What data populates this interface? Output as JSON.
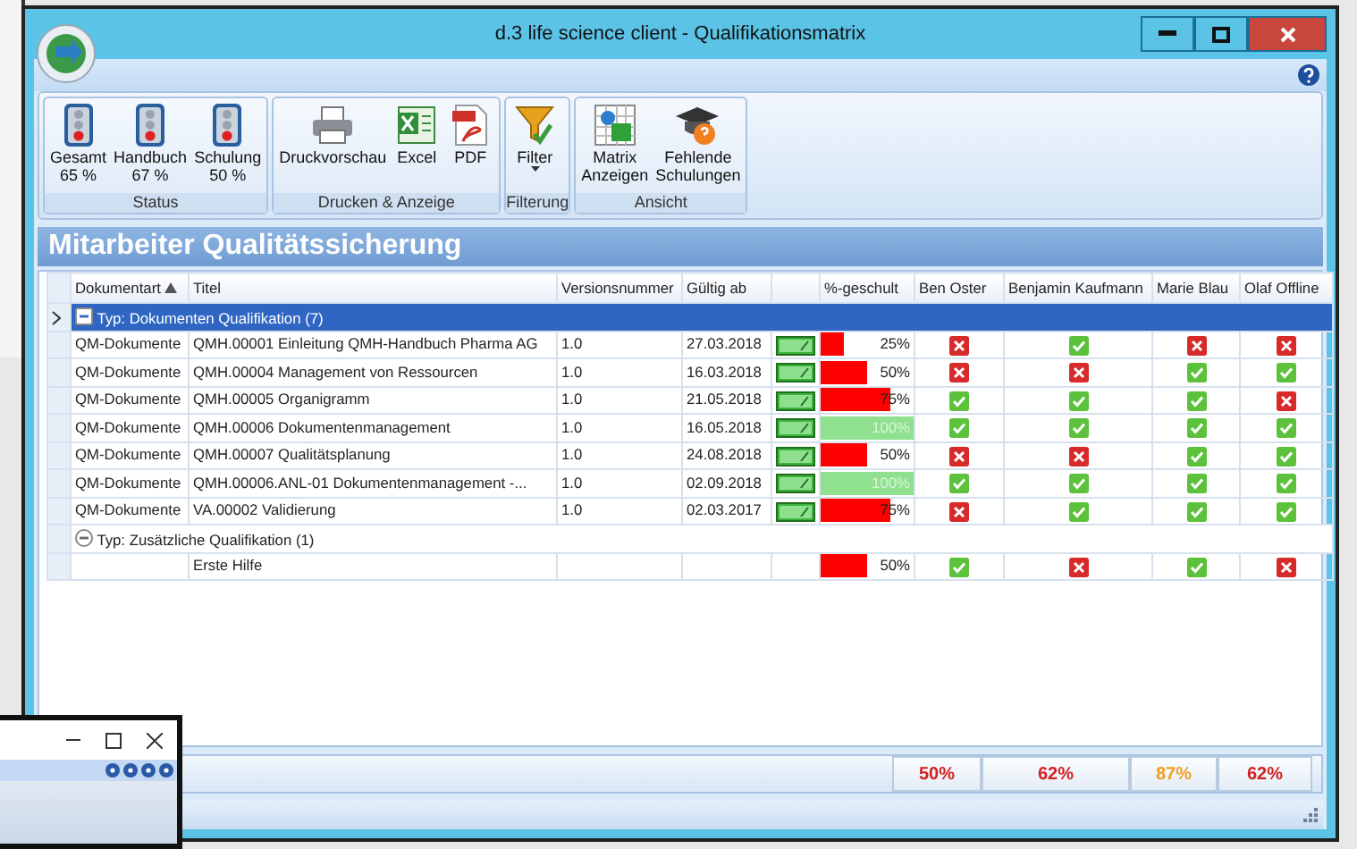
{
  "window": {
    "title": "d.3 life science client - Qualifikationsmatrix"
  },
  "ribbon": {
    "groups": [
      {
        "label": "Status",
        "buttons": [
          {
            "kind": "status",
            "label": "Gesamt",
            "sublabel": "65 %"
          },
          {
            "kind": "status",
            "label": "Handbuch",
            "sublabel": "67 %"
          },
          {
            "kind": "status",
            "label": "Schulung",
            "sublabel": "50 %"
          }
        ]
      },
      {
        "label": "Drucken & Anzeige",
        "buttons": [
          {
            "kind": "printer",
            "label": "Druckvorschau"
          },
          {
            "kind": "excel",
            "label": "Excel"
          },
          {
            "kind": "pdf",
            "label": "PDF"
          }
        ]
      },
      {
        "label": "Filterung",
        "buttons": [
          {
            "kind": "filter",
            "label": "Filter",
            "dropdown": true
          }
        ]
      },
      {
        "label": "Ansicht",
        "buttons": [
          {
            "kind": "matrix",
            "label": "Matrix",
            "sublabel": "Anzeigen"
          },
          {
            "kind": "missing",
            "label": "Fehlende",
            "sublabel": "Schulungen"
          }
        ]
      }
    ]
  },
  "panel": {
    "title": "Mitarbeiter Qualitätssicherung"
  },
  "table": {
    "columns": [
      {
        "label": "Dokumentart",
        "sorted": true
      },
      {
        "label": "Titel"
      },
      {
        "label": "Versionsnummer"
      },
      {
        "label": "Gültig ab"
      },
      {},
      {
        "label": "%-geschult"
      },
      {
        "label": "Ben Oster"
      },
      {
        "label": "Benjamin Kaufmann"
      },
      {
        "label": "Marie Blau"
      },
      {
        "label": "Olaf Offline"
      }
    ],
    "groups": [
      {
        "title": "Typ: Dokumenten Qualifikation (7)",
        "selected": true,
        "expanded": true,
        "rows": [
          {
            "type": "QM-Dokumente",
            "title": "QMH.00001 Einleitung QMH-Handbuch Pharma AG",
            "version": "1.0",
            "valid_from": "27.03.2018",
            "released": true,
            "level": 0.25,
            "percent": "25%",
            "passed": [
              false,
              true,
              false,
              false
            ]
          },
          {
            "type": "QM-Dokumente",
            "title": "QMH.00004 Management von Ressourcen",
            "version": "1.0",
            "valid_from": "16.03.2018",
            "released": true,
            "level": 0.5,
            "percent": "50%",
            "passed": [
              false,
              false,
              true,
              true
            ]
          },
          {
            "type": "QM-Dokumente",
            "title": "QMH.00005 Organigramm",
            "version": "1.0",
            "valid_from": "21.05.2018",
            "released": true,
            "level": 0.75,
            "percent": "75%",
            "passed": [
              true,
              true,
              true,
              false
            ]
          },
          {
            "type": "QM-Dokumente",
            "title": "QMH.00006 Dokumentenmanagement",
            "version": "1.0",
            "valid_from": "16.05.2018",
            "released": true,
            "level": 1,
            "percent": "100%",
            "passed": [
              true,
              true,
              true,
              true
            ]
          },
          {
            "type": "QM-Dokumente",
            "title": "QMH.00007 Qualitätsplanung",
            "version": "1.0",
            "valid_from": "24.08.2018",
            "released": true,
            "level": 0.5,
            "percent": "50%",
            "passed": [
              false,
              false,
              true,
              true
            ]
          },
          {
            "type": "QM-Dokumente",
            "title": "QMH.00006.ANL-01 Dokumentenmanagement -...",
            "version": "1.0",
            "valid_from": "02.09.2018",
            "released": true,
            "level": 1,
            "percent": "100%",
            "passed": [
              true,
              true,
              true,
              true
            ]
          },
          {
            "type": "QM-Dokumente",
            "title": "VA.00002 Validierung",
            "version": "1.0",
            "valid_from": "02.03.2017",
            "released": true,
            "level": 0.75,
            "percent": "75%",
            "passed": [
              false,
              true,
              true,
              true
            ]
          }
        ]
      },
      {
        "title": "Typ: Zusätzliche Qualifikation (1)",
        "selected": false,
        "expanded": true,
        "rows": [
          {
            "title": "Erste Hilfe",
            "level": 0.5,
            "percent": "50%",
            "passed": [
              true,
              false,
              true,
              false
            ]
          }
        ]
      }
    ],
    "totals": [
      {
        "value": "50%",
        "color": "#d42020"
      },
      {
        "value": "62%",
        "color": "#d42020"
      },
      {
        "value": "87%",
        "color": "#f0a020"
      },
      {
        "value": "62%",
        "color": "#d42020"
      }
    ]
  }
}
